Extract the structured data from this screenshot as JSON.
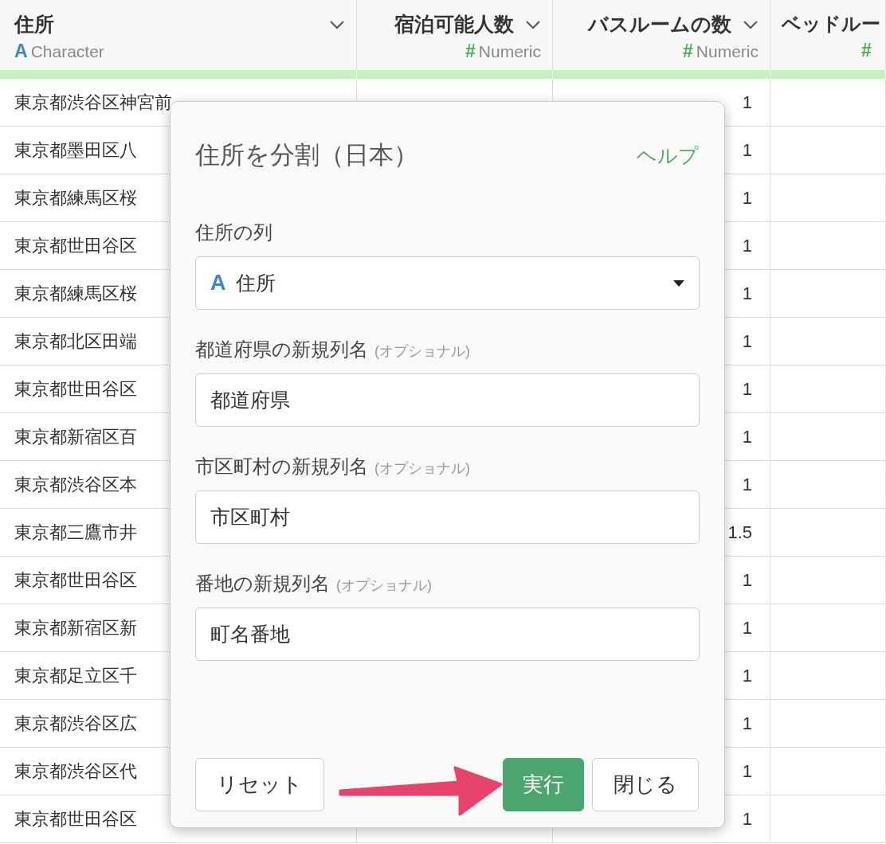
{
  "table": {
    "columns": [
      {
        "title": "住所",
        "type_icon": "A",
        "type": "Character",
        "kind": "text"
      },
      {
        "title": "宿泊可能人数",
        "type_icon": "#",
        "type": "Numeric",
        "kind": "number"
      },
      {
        "title": "バスルームの数",
        "type_icon": "#",
        "type": "Numeric",
        "kind": "number"
      },
      {
        "title": "ベッドルー",
        "type_icon": "#",
        "kind": "cut"
      }
    ],
    "rows": [
      {
        "address": "東京都渋谷区神宮前",
        "bathrooms": "1"
      },
      {
        "address": "東京都墨田区八",
        "bathrooms": "1"
      },
      {
        "address": "東京都練馬区桜",
        "bathrooms": "1"
      },
      {
        "address": "東京都世田谷区",
        "bathrooms": "1"
      },
      {
        "address": "東京都練馬区桜",
        "bathrooms": "1"
      },
      {
        "address": "東京都北区田端",
        "bathrooms": "1"
      },
      {
        "address": "東京都世田谷区",
        "bathrooms": "1"
      },
      {
        "address": "東京都新宿区百",
        "bathrooms": "1"
      },
      {
        "address": "東京都渋谷区本",
        "bathrooms": "1"
      },
      {
        "address": "東京都三鷹市井",
        "bathrooms": "1.5"
      },
      {
        "address": "東京都世田谷区",
        "bathrooms": "1"
      },
      {
        "address": "東京都新宿区新",
        "bathrooms": "1"
      },
      {
        "address": "東京都足立区千",
        "bathrooms": "1"
      },
      {
        "address": "東京都渋谷区広",
        "bathrooms": "1"
      },
      {
        "address": "東京都渋谷区代",
        "bathrooms": "1"
      },
      {
        "address": "東京都世田谷区",
        "bathrooms": "1"
      }
    ]
  },
  "dialog": {
    "title": "住所を分割（日本）",
    "help": "ヘルプ",
    "fields": [
      {
        "kind": "select",
        "label": "住所の列",
        "type_icon": "A",
        "value": "住所"
      },
      {
        "kind": "text",
        "label": "都道府県の新規列名",
        "note": "(オプショナル)",
        "value": "都道府県"
      },
      {
        "kind": "text",
        "label": "市区町村の新規列名",
        "note": "(オプショナル)",
        "value": "市区町村"
      },
      {
        "kind": "text",
        "label": "番地の新規列名",
        "note": "(オプショナル)",
        "value": "町名番地"
      }
    ],
    "buttons": [
      {
        "label": "リセット",
        "primary": false
      },
      {
        "label": "実行",
        "primary": true
      },
      {
        "label": "閉じる",
        "primary": false
      }
    ]
  }
}
